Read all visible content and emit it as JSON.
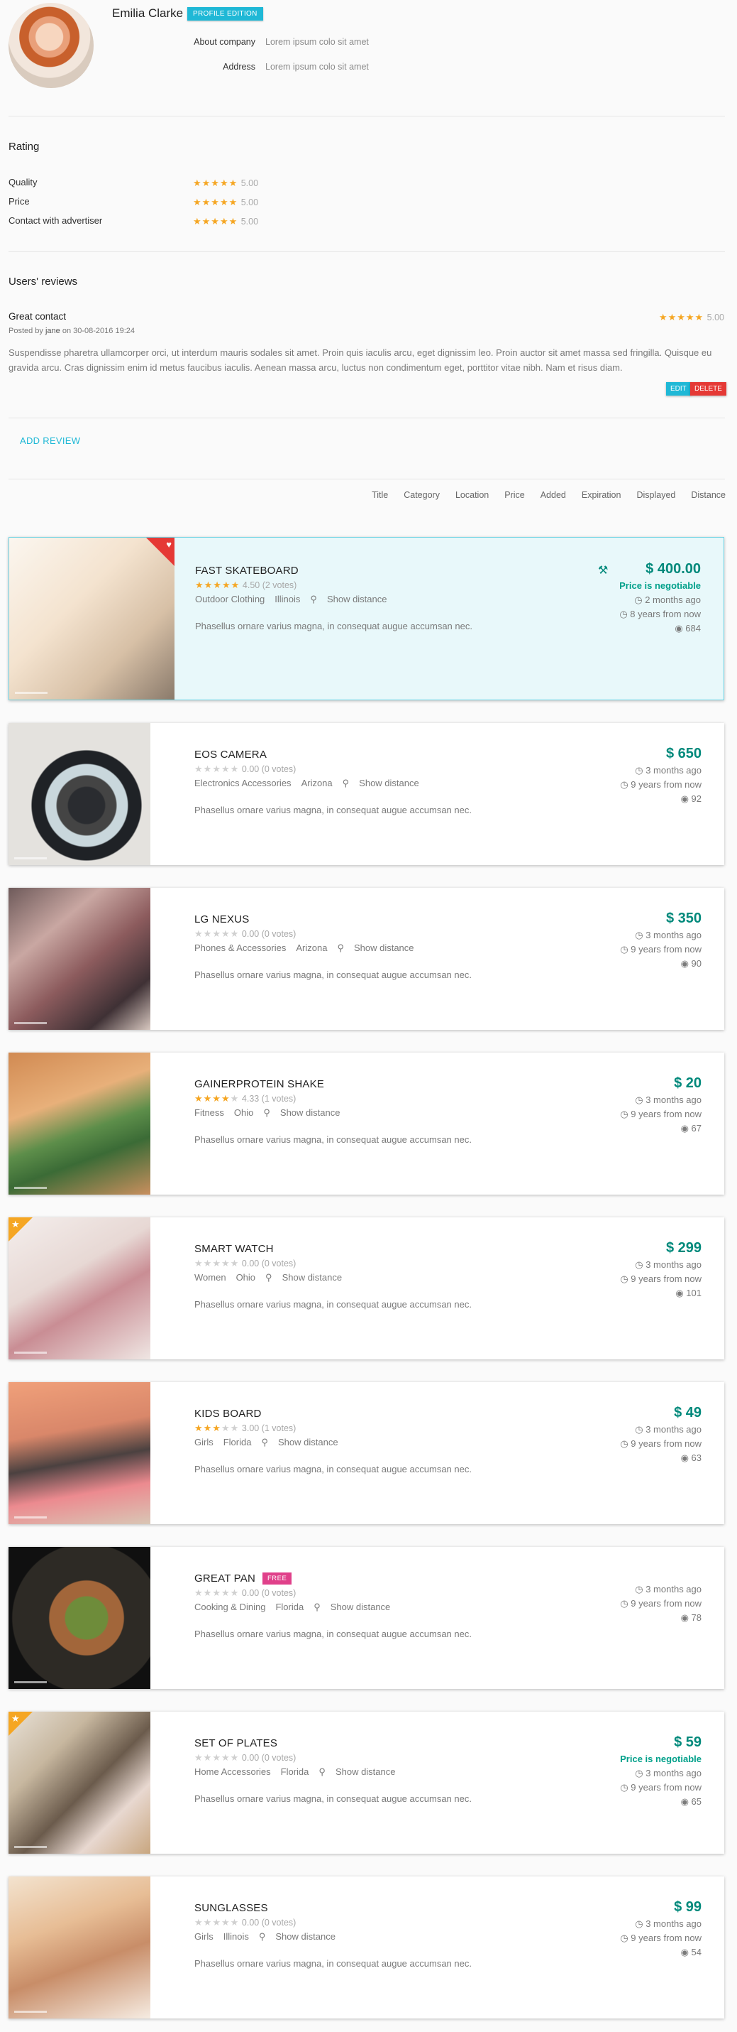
{
  "profile": {
    "name": "Emilia Clarke",
    "badge": "PROFILE EDITION",
    "about_label": "About company",
    "about_value": "Lorem ipsum colo sit amet",
    "address_label": "Address",
    "address_value": "Lorem ipsum colo sit amet"
  },
  "rating": {
    "title": "Rating",
    "items": [
      {
        "label": "Quality",
        "score": "5.00"
      },
      {
        "label": "Price",
        "score": "5.00"
      },
      {
        "label": "Contact with advertiser",
        "score": "5.00"
      }
    ]
  },
  "reviews": {
    "title": "Users' reviews",
    "item": {
      "title": "Great contact",
      "meta_prefix": "Posted by",
      "author": "jane",
      "meta_suffix": "on 30-08-2016 19:24",
      "score": "5.00",
      "text": "Suspendisse pharetra ullamcorper orci, ut interdum mauris sodales sit amet. Proin quis iaculis arcu, eget dignissim leo. Proin auctor sit amet massa sed fringilla. Quisque eu gravida arcu. Cras dignissim enim id metus faucibus iaculis. Aenean massa arcu, luctus non condimentum eget, porttitor vitae nibh. Nam et risus diam.",
      "edit_label": "EDIT",
      "delete_label": "DELETE"
    },
    "add_label": "ADD REVIEW"
  },
  "sort": [
    "Title",
    "Category",
    "Location",
    "Price",
    "Added",
    "Expiration",
    "Displayed",
    "Distance"
  ],
  "show_distance": "Show distance",
  "description": "Phasellus ornare varius magna, in consequat augue accumsan nec.",
  "listings": [
    {
      "title": "FAST SKATEBOARD",
      "rating": 4.5,
      "rating_text": "4.50 (2 votes)",
      "category": "Outdoor Clothing",
      "location": "Illinois",
      "price": "$ 400.00",
      "negotiable": "Price is negotiable",
      "added": "2 months ago",
      "expires": "8 years from now",
      "views": "684",
      "highlight": true,
      "favorite": true
    },
    {
      "title": "EOS CAMERA",
      "rating": 0,
      "rating_text": "0.00 (0 votes)",
      "category": "Electronics Accessories",
      "location": "Arizona",
      "price": "$ 650",
      "added": "3 months ago",
      "expires": "9 years from now",
      "views": "92"
    },
    {
      "title": "LG NEXUS",
      "rating": 0,
      "rating_text": "0.00 (0 votes)",
      "category": "Phones & Accessories",
      "location": "Arizona",
      "price": "$ 350",
      "added": "3 months ago",
      "expires": "9 years from now",
      "views": "90"
    },
    {
      "title": "GAINERPROTEIN SHAKE",
      "rating": 4.33,
      "rating_text": "4.33 (1 votes)",
      "category": "Fitness",
      "location": "Ohio",
      "price": "$ 20",
      "added": "3 months ago",
      "expires": "9 years from now",
      "views": "67"
    },
    {
      "title": "SMART WATCH",
      "rating": 0,
      "rating_text": "0.00 (0 votes)",
      "category": "Women",
      "location": "Ohio",
      "price": "$ 299",
      "added": "3 months ago",
      "expires": "9 years from now",
      "views": "101",
      "featured": true
    },
    {
      "title": "KIDS BOARD",
      "rating": 3,
      "rating_text": "3.00 (1 votes)",
      "category": "Girls",
      "location": "Florida",
      "price": "$ 49",
      "added": "3 months ago",
      "expires": "9 years from now",
      "views": "63"
    },
    {
      "title": "GREAT PAN",
      "tag": "FREE",
      "rating": 0,
      "rating_text": "0.00 (0 votes)",
      "category": "Cooking & Dining",
      "location": "Florida",
      "price": "",
      "added": "3 months ago",
      "expires": "9 years from now",
      "views": "78"
    },
    {
      "title": "SET OF PLATES",
      "rating": 0,
      "rating_text": "0.00 (0 votes)",
      "category": "Home Accessories",
      "location": "Florida",
      "price": "$ 59",
      "negotiable": "Price is negotiable",
      "added": "3 months ago",
      "expires": "9 years from now",
      "views": "65",
      "featured": true
    },
    {
      "title": "SUNGLASSES",
      "rating": 0,
      "rating_text": "0.00 (0 votes)",
      "category": "Girls",
      "location": "Illinois",
      "price": "$ 99",
      "added": "3 months ago",
      "expires": "9 years from now",
      "views": "54"
    }
  ],
  "colors": {
    "accent": "#1fb8d6",
    "price": "#00897b",
    "star": "#f5a623",
    "delete": "#e53935",
    "free": "#e0408a"
  }
}
